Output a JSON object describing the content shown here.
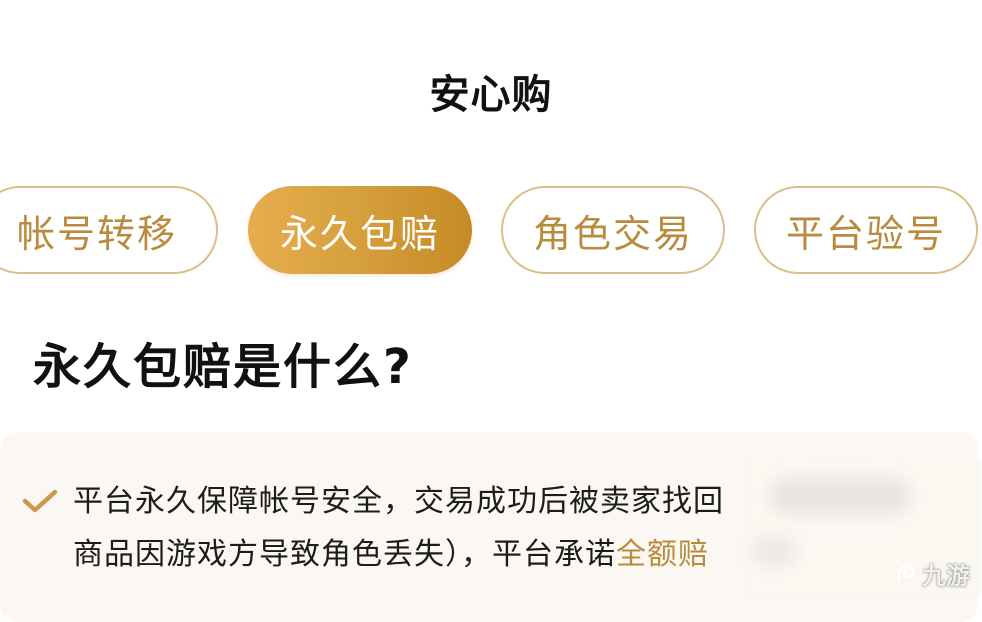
{
  "header": {
    "title": "安心购"
  },
  "tabs": [
    {
      "label": "帐号转移",
      "active": false
    },
    {
      "label": "永久包赔",
      "active": true
    },
    {
      "label": "角色交易",
      "active": false
    },
    {
      "label": "平台验号",
      "active": false
    }
  ],
  "section": {
    "heading": "永久包赔是什么?"
  },
  "info": {
    "icon": "check-icon",
    "line1": "平台永久保障帐号安全，交易成功后被卖家找回",
    "line2_plain": "商品因游戏方导致角色丢失），平台承诺",
    "line2_highlight": "全额赔"
  },
  "watermark": {
    "text": "九游",
    "icon": "jiuyou-logo-icon"
  },
  "colors": {
    "accent_gold": "#b98b3f",
    "active_tab_start": "#e6ad4f",
    "active_tab_end": "#c58b27",
    "tab_border": "#d9bf8a",
    "card_background": "#fbf7f2"
  }
}
